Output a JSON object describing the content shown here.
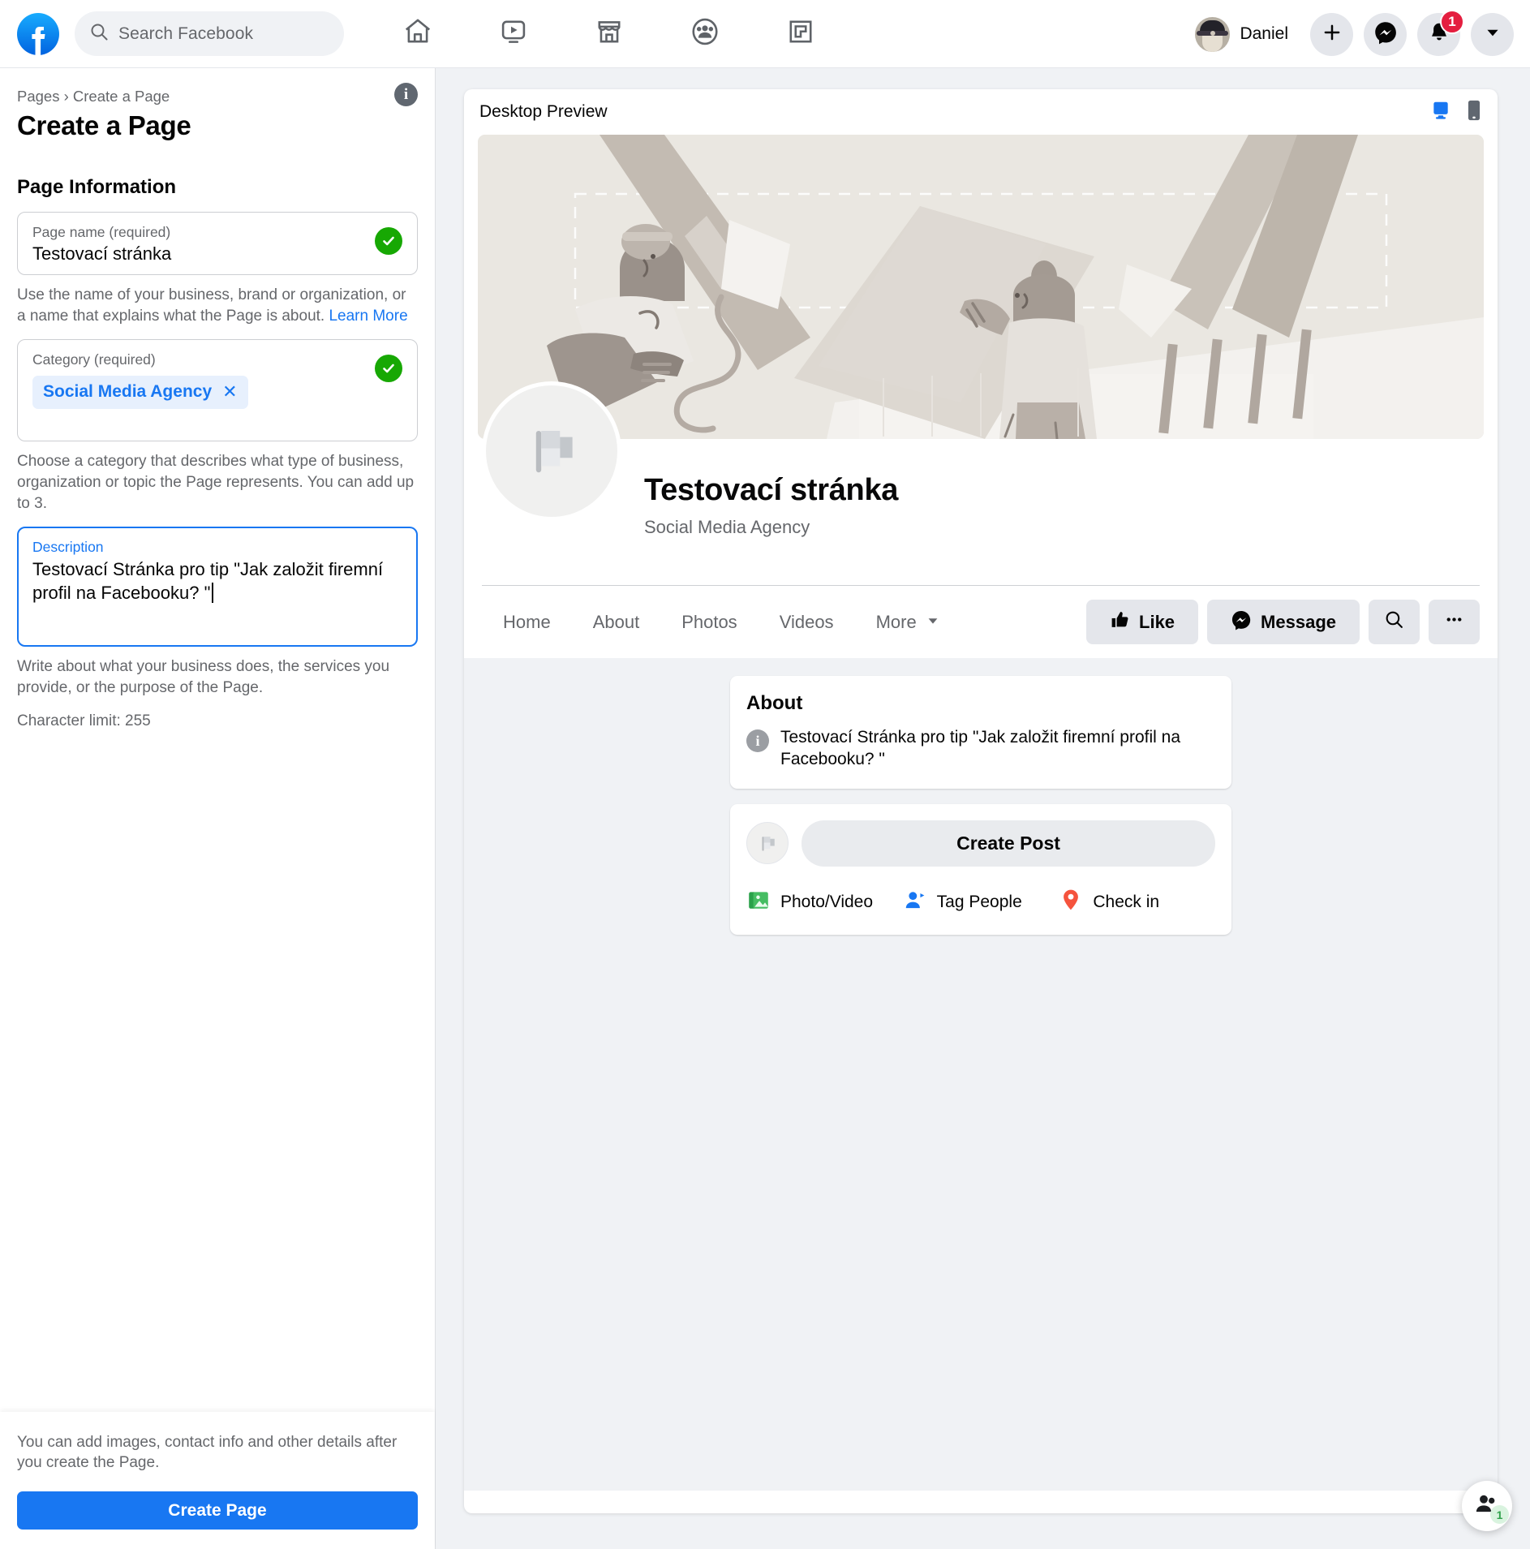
{
  "topbar": {
    "logo_icon": "facebook-logo-icon",
    "search": {
      "placeholder": "Search Facebook",
      "value": "",
      "icon": "search-icon"
    },
    "nav": [
      {
        "name": "home",
        "icon": "home-icon"
      },
      {
        "name": "watch",
        "icon": "video-play-icon"
      },
      {
        "name": "marketplace",
        "icon": "storefront-icon"
      },
      {
        "name": "groups",
        "icon": "people-group-icon"
      },
      {
        "name": "gaming",
        "icon": "gaming-controller-icon"
      }
    ],
    "profile_name": "Daniel",
    "create_icon": "plus-icon",
    "messenger_icon": "messenger-icon",
    "notifications_icon": "bell-icon",
    "notifications_count": "1",
    "account_icon": "chevron-down-icon"
  },
  "sidebar": {
    "breadcrumb": "Pages › Create a Page",
    "title": "Create a Page",
    "info_icon_label": "i",
    "section_heading": "Page Information",
    "page_name": {
      "label": "Page name (required)",
      "value": "Testovací stránka",
      "valid_icon": "check-circle-icon"
    },
    "page_name_help": "Use the name of your business, brand or organization, or a name that explains what the Page is about. ",
    "page_name_help_link": "Learn More",
    "category": {
      "label": "Category (required)",
      "chips": [
        {
          "label": "Social Media Agency",
          "remove_icon": "close-icon"
        }
      ],
      "valid_icon": "check-circle-icon"
    },
    "category_help": "Choose a category that describes what type of business, organization or topic the Page represents. You can add up to 3.",
    "description": {
      "label": "Description",
      "value": "Testovací Stránka pro tip \"Jak založit firemní profil na Facebooku? \""
    },
    "description_help": "Write about what your business does, the services you provide, or the purpose of the Page.",
    "character_limit": "Character limit: 255",
    "footer_note": "You can add images, contact info and other details after you create the Page.",
    "create_button": "Create Page"
  },
  "preview": {
    "header_title": "Desktop Preview",
    "desktop_toggle_icon": "desktop-monitor-icon",
    "mobile_toggle_icon": "mobile-phone-icon",
    "active_toggle": "desktop",
    "cover_alt": "cover-photo-illustration",
    "profile_picture_icon": "flag-placeholder-icon",
    "page_name": "Testovací stránka",
    "page_category": "Social Media Agency",
    "tabs": [
      {
        "label": "Home"
      },
      {
        "label": "About"
      },
      {
        "label": "Photos"
      },
      {
        "label": "Videos"
      },
      {
        "label": "More",
        "caret_icon": "chevron-down-icon"
      }
    ],
    "actions": {
      "like_label": "Like",
      "like_icon": "thumbs-up-icon",
      "message_label": "Message",
      "message_icon": "messenger-icon",
      "search_icon": "search-icon",
      "more_icon": "ellipsis-icon"
    },
    "about_card": {
      "heading": "About",
      "info_icon_label": "i",
      "text": "Testovací Stránka pro tip \"Jak založit firemní profil na Facebooku? \""
    },
    "create_post_card": {
      "avatar_icon": "flag-placeholder-icon",
      "box_label": "Create Post",
      "actions": [
        {
          "label": "Photo/Video",
          "icon": "photo-video-icon",
          "color": "#45bd62"
        },
        {
          "label": "Tag People",
          "icon": "tag-people-icon",
          "color": "#1877f2"
        },
        {
          "label": "Check in",
          "icon": "location-pin-icon",
          "color": "#f5533d"
        }
      ]
    }
  },
  "floating": {
    "contacts_icon": "contacts-people-icon",
    "badge_count": "1"
  },
  "colors": {
    "brand_blue": "#1877f2",
    "valid_green": "#17a803",
    "badge_red": "#e41e3f",
    "page_bg": "#f0f2f5",
    "chip_bg": "#e7f0fd"
  }
}
